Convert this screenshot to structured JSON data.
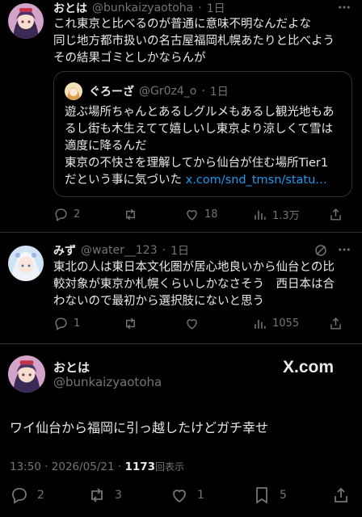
{
  "tweet1": {
    "name": "おとは",
    "handle": "@bunkaizyaotoha",
    "dot": "·",
    "time": "1日",
    "lines": [
      "これ東京と比べるのが普通に意味不明なんだよな",
      "同じ地方都市扱いの名古屋福岡札幌あたりと比べよう",
      "その結果ゴミとしかならんが"
    ],
    "quote": {
      "name": "ぐろーざ",
      "handle": "@Gr0z4_o",
      "time": "1日",
      "lines": [
        "遊ぶ場所ちゃんとあるしグルメもあるし観光地もあ",
        "るし街も木生えてて嬉しいし東京より涼しくて雪は",
        "適度に降るんだ",
        "東京の不快さを理解してから仙台が住む場所Tier1",
        "だという事に気づいた "
      ],
      "link": "x.com/snd_tmsn/statu…"
    },
    "stats": {
      "replies": "2",
      "likes": "18",
      "views": "1.3万"
    }
  },
  "tweet2": {
    "name": "みず",
    "handle": "@water__123",
    "time": "1日",
    "lines": [
      "東北の人は東日本文化圏が居心地良いから仙台との比",
      "較対象が東京か札幌くらいしかなさそう　西日本は合",
      "わないので最初から選択肢にないと思う"
    ],
    "stats": {
      "replies": "1",
      "views": "1055"
    }
  },
  "tweet3": {
    "name": "おとは",
    "handle": "@bunkaizyaotoha",
    "brand": "X.com",
    "text": "ワイ仙台から福岡に引っ越したけどガチ幸せ",
    "timestamp": "13:50 · 2026/05/21 · ",
    "views_count": "1173",
    "views_label": "回表示",
    "stats": {
      "replies": "2",
      "retweets": "3",
      "likes": "1",
      "bookmarks": "5"
    }
  },
  "colors": {
    "background": "#000000",
    "text": "#e7e9ea",
    "muted": "#71767b",
    "link": "#1d9bf0",
    "border": "#2f3336"
  }
}
